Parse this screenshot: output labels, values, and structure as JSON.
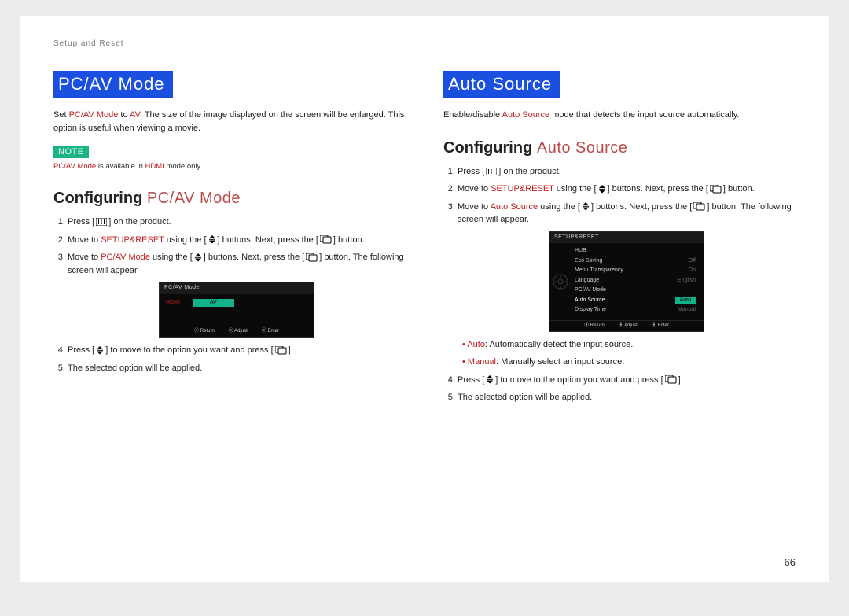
{
  "header": "Setup and Reset",
  "page_number": "66",
  "left": {
    "h1": "PC/AV Mode",
    "intro_a": "Set ",
    "intro_red1": "PC/AV Mode",
    "intro_b": " to ",
    "intro_red2": "AV",
    "intro_c": ". The size of the image displayed on the screen will be enlarged. This option is useful when viewing a movie.",
    "note_label": "NOTE",
    "note_red": "PC/AV Mode",
    "note_mid": " is available in ",
    "note_red2": "HDMI",
    "note_end": " mode only.",
    "sub_a": "Configuring ",
    "sub_b": "PC/AV Mode",
    "s1": "Press [",
    "s1b": "] on the product.",
    "s2a": "Move to ",
    "s2red": "SETUP&RESET",
    "s2b": " using the [",
    "s2c": "] buttons. Next, press the [",
    "s2d": "] button.",
    "s3a": "Move to ",
    "s3red": "PC/AV Mode",
    "s3b": " using the [",
    "s3c": "] buttons. Next, press the [",
    "s3d": "] button. The following screen will appear.",
    "s4a": "Press [",
    "s4b": "] to move to the option you want and press [",
    "s4c": "].",
    "s5": "The selected option will be applied.",
    "osd": {
      "title": "PC/AV Mode",
      "row_label": "HDMI",
      "sel": "AV",
      "foot_return": "Return",
      "foot_adjust": "Adjust",
      "foot_enter": "Enter"
    }
  },
  "right": {
    "h1": "Auto Source",
    "intro_a": "Enable/disable ",
    "intro_red": "Auto Source",
    "intro_b": " mode that detects the input source automatically.",
    "sub_a": "Configuring ",
    "sub_b": "Auto Source",
    "s1": "Press [",
    "s1b": "] on the product.",
    "s2a": "Move to ",
    "s2red": "SETUP&RESET",
    "s2b": " using the [",
    "s2c": "] buttons. Next, press the [",
    "s2d": "] button.",
    "s3a": "Move to ",
    "s3red": "Auto Source",
    "s3b": " using the [",
    "s3c": "] buttons. Next, press the [",
    "s3d": "] button. The following screen will appear.",
    "b1red": "Auto",
    "b1": ": Automatically detect the input source.",
    "b2red": "Manual",
    "b2": ": Manually select an input source.",
    "s4a": "Press [",
    "s4b": "] to move to the option you want and press [",
    "s4c": "].",
    "s5": "The selected option will be applied.",
    "osd": {
      "title": "SETUP&RESET",
      "rows": [
        {
          "label": "HUB",
          "v": ""
        },
        {
          "label": "Eco Saving",
          "v": "Off"
        },
        {
          "label": "Menu Transparency",
          "v": "On"
        },
        {
          "label": "Language",
          "v": "English"
        },
        {
          "label": "PC/AV Mode",
          "v": ""
        }
      ],
      "sel_label": "Auto Source",
      "sel_value": "Auto",
      "extra_label": "Display Time",
      "extra_value": "Manual",
      "foot_return": "Return",
      "foot_adjust": "Adjust",
      "foot_enter": "Enter"
    }
  }
}
